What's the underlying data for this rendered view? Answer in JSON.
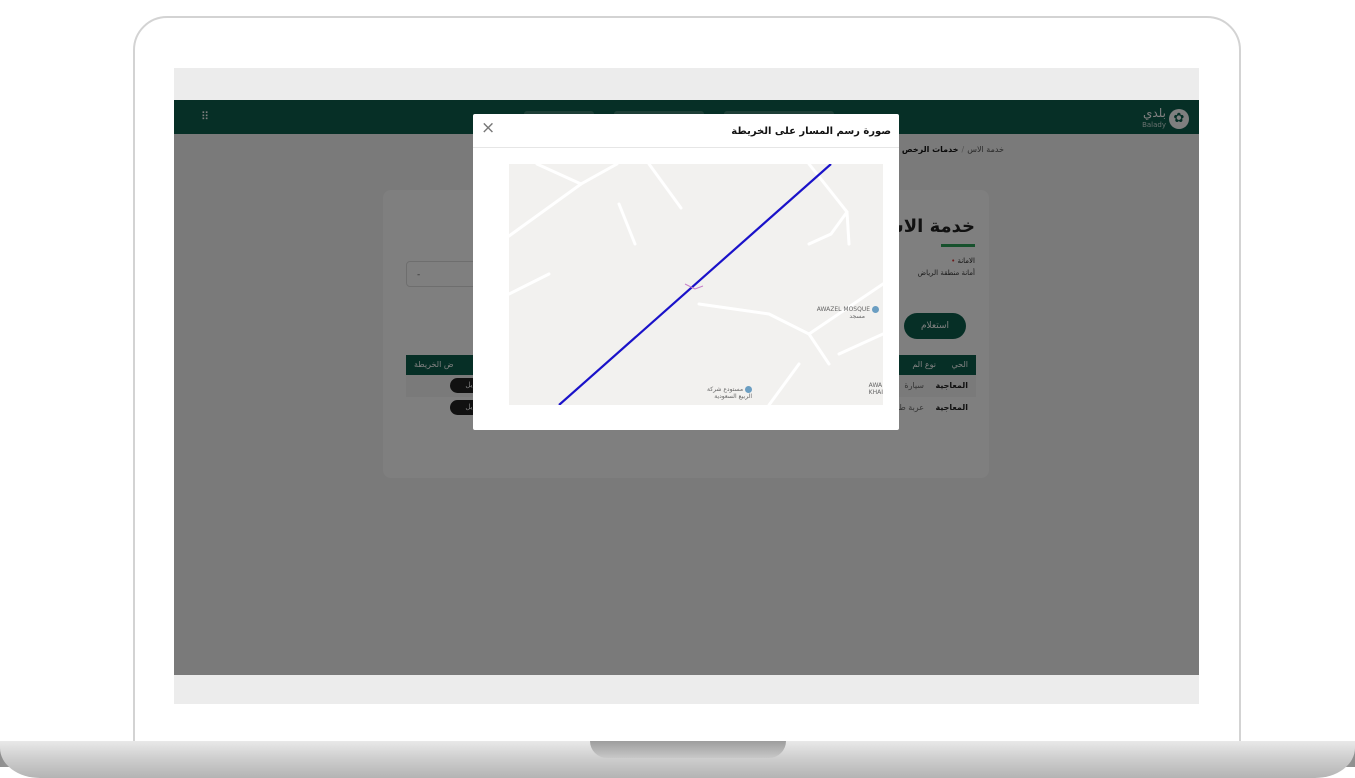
{
  "app": {
    "logo_ar": "بلدي",
    "logo_en": "Balady",
    "apps_icon": "grid-icon"
  },
  "breadcrumb": {
    "root": "خدمات الرخص",
    "current": "خدمة الاس"
  },
  "service": {
    "title": "خدمة الاس",
    "field_label": "الامانة",
    "field_value": "أمانة منطقة الرياض",
    "select_placeholder": "-",
    "query_button": "استعلام"
  },
  "table": {
    "headers": [
      "الحي",
      "نوع الم",
      "ض الخريطة"
    ],
    "rows": [
      {
        "district": "المعاجية",
        "type": "سيارة",
        "action": "يل"
      },
      {
        "district": "المعاجية",
        "type": "عربة ط",
        "action": "يل"
      }
    ]
  },
  "modal": {
    "title": "صورة رسم المسار على الخريطة",
    "close_glyph": "×",
    "close_icon": "close-icon",
    "map": {
      "poi_1_line1": "AWAZEL MOSQUE",
      "poi_1_line2": "مسجد",
      "poi_2_line1": "مستودع شركة",
      "poi_2_line2": "الربيع السعودية",
      "poi_3_line1": "AWA",
      "poi_3_line2": "KHAI",
      "route_color": "#1a12c9",
      "pin_icon": "map-pin-icon"
    }
  },
  "colors": {
    "primary": "#0c5f4d",
    "accent": "#2fa35b",
    "route": "#1a12c9"
  }
}
